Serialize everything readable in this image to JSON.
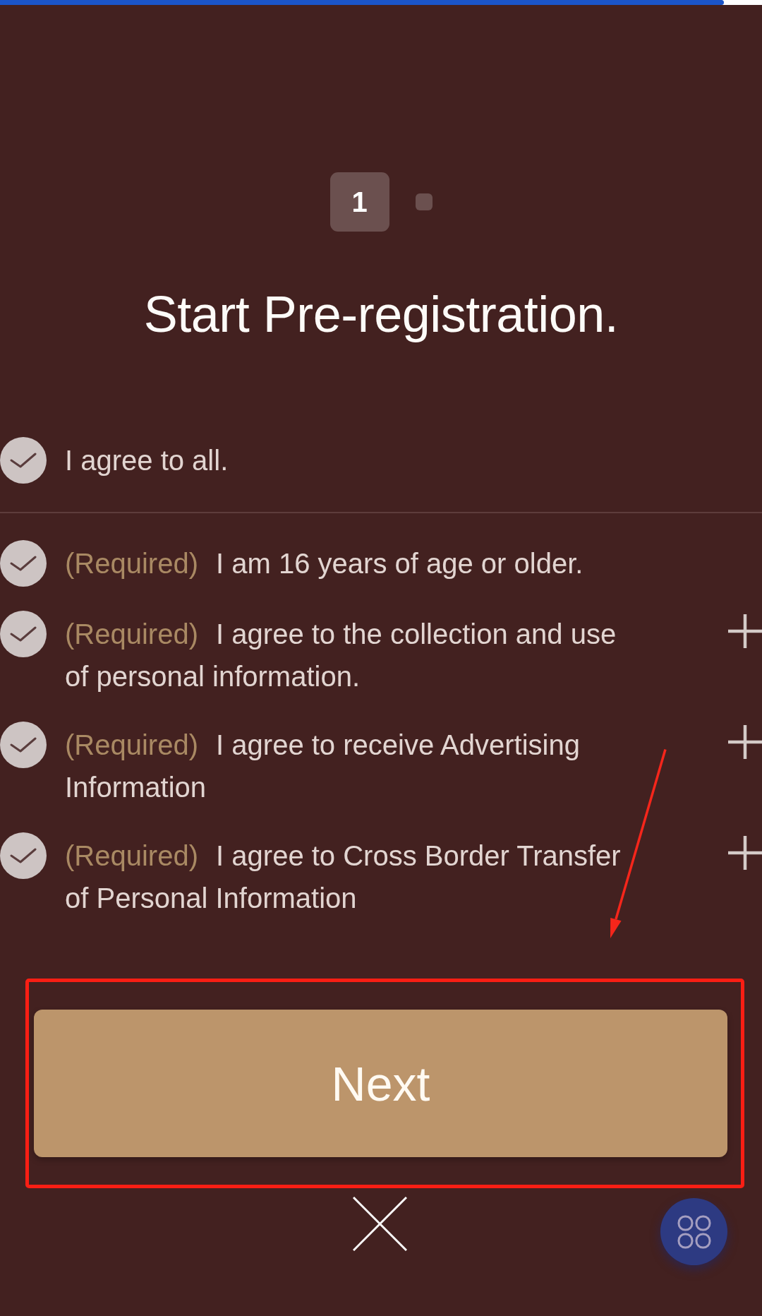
{
  "progress": {
    "level": 0.95
  },
  "steps": [
    {
      "label": "1",
      "selected": true
    },
    {
      "selected": false
    }
  ],
  "title": "Start Pre-registration.",
  "agree_all": {
    "label": "I agree to all.",
    "checked": false
  },
  "terms": [
    {
      "kind": "plain",
      "tag": "(Required)",
      "text": "I am 16 years of age or older.",
      "checked": false
    },
    {
      "kind": "detail",
      "tag": "(Required)",
      "text": "I agree to the collection and use of personal information.",
      "checked": false
    },
    {
      "kind": "detail",
      "tag": "(Required)",
      "text": "I agree to receive Advertising Information",
      "checked": false
    },
    {
      "kind": "detail",
      "tag": "(Required)",
      "text": "I agree to Cross Border Transfer of Personal Information",
      "checked": false
    }
  ],
  "next_button": {
    "label": "Next"
  }
}
